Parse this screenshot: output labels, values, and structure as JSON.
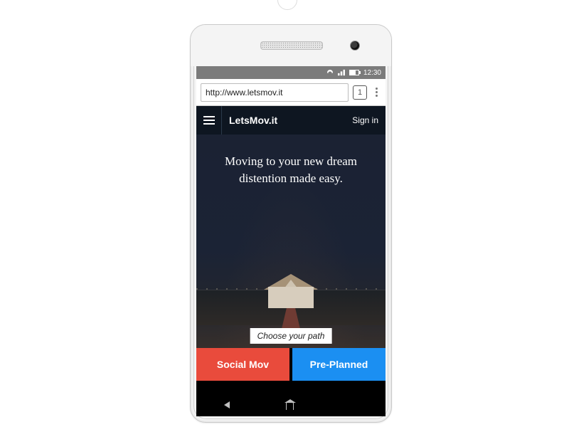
{
  "statusbar": {
    "time": "12:30"
  },
  "browser": {
    "url": "http://www.letsmov.it",
    "tab_count": "1"
  },
  "app": {
    "brand": "LetsMov.it",
    "signin": "Sign in",
    "hero_text": "Moving to your new dream distention made easy.",
    "choose_label": "Choose your path",
    "buttons": {
      "social": "Social Mov",
      "pre": "Pre-Planned"
    }
  }
}
